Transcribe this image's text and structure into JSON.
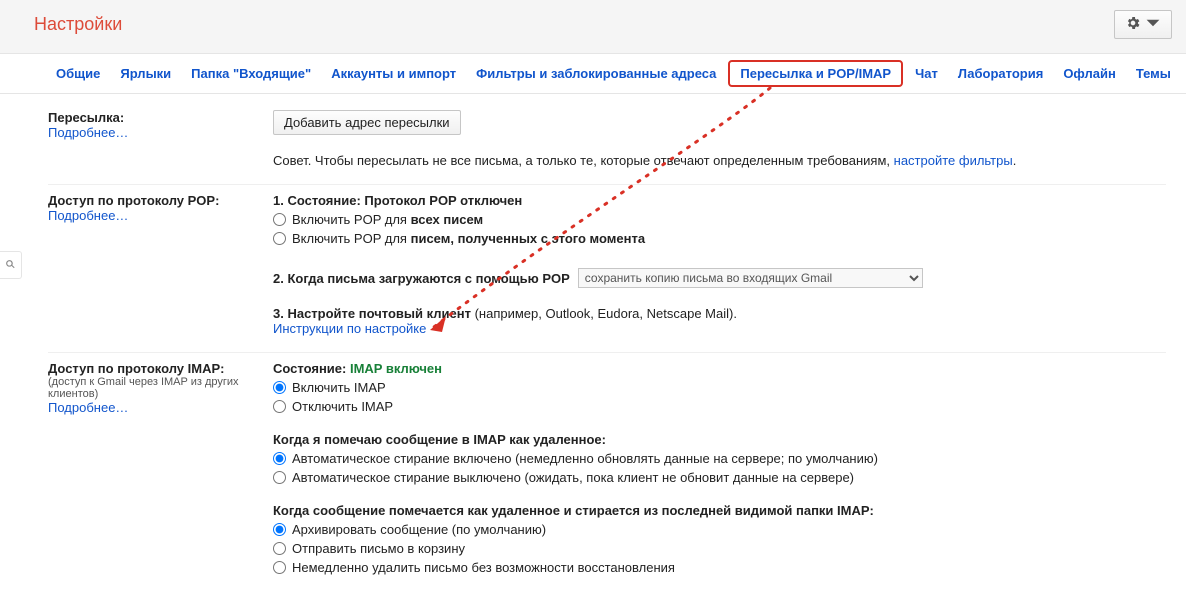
{
  "header": {
    "title": "Настройки",
    "gear_icon": "gear"
  },
  "tabs": [
    {
      "label": "Общие"
    },
    {
      "label": "Ярлыки"
    },
    {
      "label": "Папка \"Входящие\""
    },
    {
      "label": "Аккаунты и импорт"
    },
    {
      "label": "Фильтры и заблокированные адреса"
    },
    {
      "label": "Пересылка и POP/IMAP",
      "active": true
    },
    {
      "label": "Чат"
    },
    {
      "label": "Лаборатория"
    },
    {
      "label": "Офлайн"
    },
    {
      "label": "Темы"
    }
  ],
  "forwarding": {
    "heading": "Пересылка:",
    "more": "Подробнее…",
    "add_button": "Добавить адрес пересылки",
    "tip_prefix": "Совет. Чтобы пересылать не все письма, а только те, которые отвечают определенным требованиям, ",
    "tip_link": "настройте фильтры",
    "tip_suffix": "."
  },
  "pop": {
    "heading": "Доступ по протоколу POP:",
    "more": "Подробнее…",
    "status_line_prefix": "1. Состояние: ",
    "status_line_value": "Протокол POP отключен",
    "opt_all_prefix": "Включить POP для ",
    "opt_all_bold": "всех писем",
    "opt_new_prefix": "Включить POP для ",
    "opt_new_bold": "писем, полученных с этого момента",
    "download_label": "2. Когда письма загружаются с помощью POP",
    "download_select": "сохранить копию письма во входящих Gmail",
    "client_prefix": "3. Настройте почтовый клиент",
    "client_paren": " (например, Outlook, Eudora, Netscape Mail).",
    "client_link": "Инструкции по настройке"
  },
  "imap": {
    "heading": "Доступ по протоколу IMAP:",
    "sub": "(доступ к Gmail через IMAP из других клиентов)",
    "more": "Подробнее…",
    "status_prefix": "Состояние: ",
    "status_value": "IMAP включен",
    "opt_enable": "Включить IMAP",
    "opt_disable": "Отключить IMAP",
    "expunge_heading": "Когда я помечаю сообщение в IMAP как удаленное:",
    "expunge_on": "Автоматическое стирание включено (немедленно обновлять данные на сервере; по умолчанию)",
    "expunge_off": "Автоматическое стирание выключено (ожидать, пока клиент не обновит данные на сервере)",
    "lastfolder_heading": "Когда сообщение помечается как удаленное и стирается из последней видимой папки IMAP:",
    "lf_archive": "Архивировать сообщение (по умолчанию)",
    "lf_trash": "Отправить письмо в корзину",
    "lf_delete": "Немедленно удалить письмо без возможности восстановления"
  }
}
